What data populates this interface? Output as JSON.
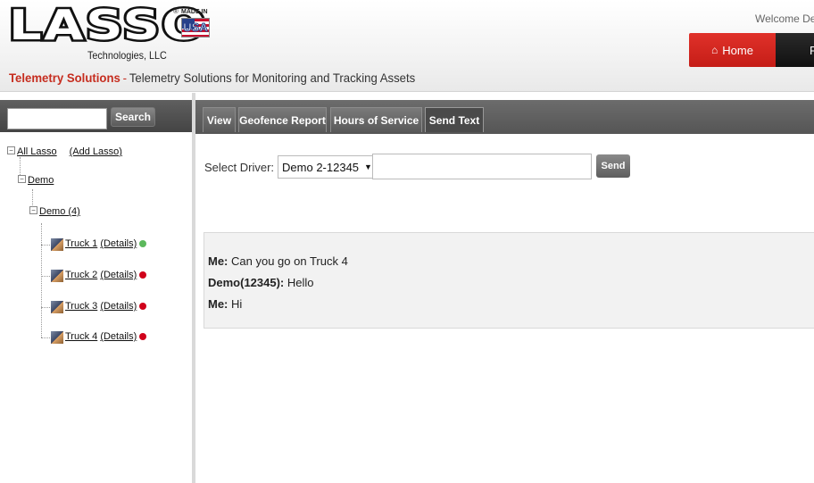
{
  "header": {
    "logo_text": "LASSO",
    "logo_subtitle": "Technologies, LLC",
    "made_in_text": "MADE IN",
    "flag_text": "USA",
    "tagline_brand": "Telemetry Solutions",
    "tagline_separator": "-",
    "tagline_rest": "Telemetry Solutions for Monitoring and Tracking Assets",
    "welcome_text": "Welcome Der",
    "nav": {
      "home_label": "Home",
      "home_icon": "home-icon",
      "next_label": "F"
    }
  },
  "sidebar": {
    "search_placeholder": "",
    "search_button_label": "Search",
    "tree": {
      "root_label": "All Lasso",
      "add_label": "(Add Lasso)",
      "group_label": "Demo",
      "subgroup_label": "Demo (4)",
      "trucks": [
        {
          "name": "Truck 1",
          "details": "(Details)",
          "status_color": "#5cb85c"
        },
        {
          "name": "Truck 2",
          "details": "(Details)",
          "status_color": "#d0021b"
        },
        {
          "name": "Truck 3",
          "details": "(Details)",
          "status_color": "#d0021b"
        },
        {
          "name": "Truck 4",
          "details": "(Details)",
          "status_color": "#d0021b"
        }
      ]
    }
  },
  "main": {
    "tabs": [
      {
        "label": "View",
        "active": false
      },
      {
        "label": "Geofence Report",
        "active": false
      },
      {
        "label": "Hours of Service",
        "active": false
      },
      {
        "label": "Send Text",
        "active": true
      }
    ],
    "driver_label": "Select Driver:",
    "driver_selected": "Demo 2-12345",
    "message_value": "",
    "send_label": "Send",
    "messages": [
      {
        "author": "Me:",
        "text": "Can you go on Truck 4"
      },
      {
        "author": "Demo(12345):",
        "text": "Hello"
      },
      {
        "author": "Me:",
        "text": "Hi"
      }
    ]
  },
  "colors": {
    "brand_red": "#c62d1f",
    "nav_red": "#d42a22",
    "status_green": "#5cb85c",
    "status_red": "#d0021b"
  }
}
